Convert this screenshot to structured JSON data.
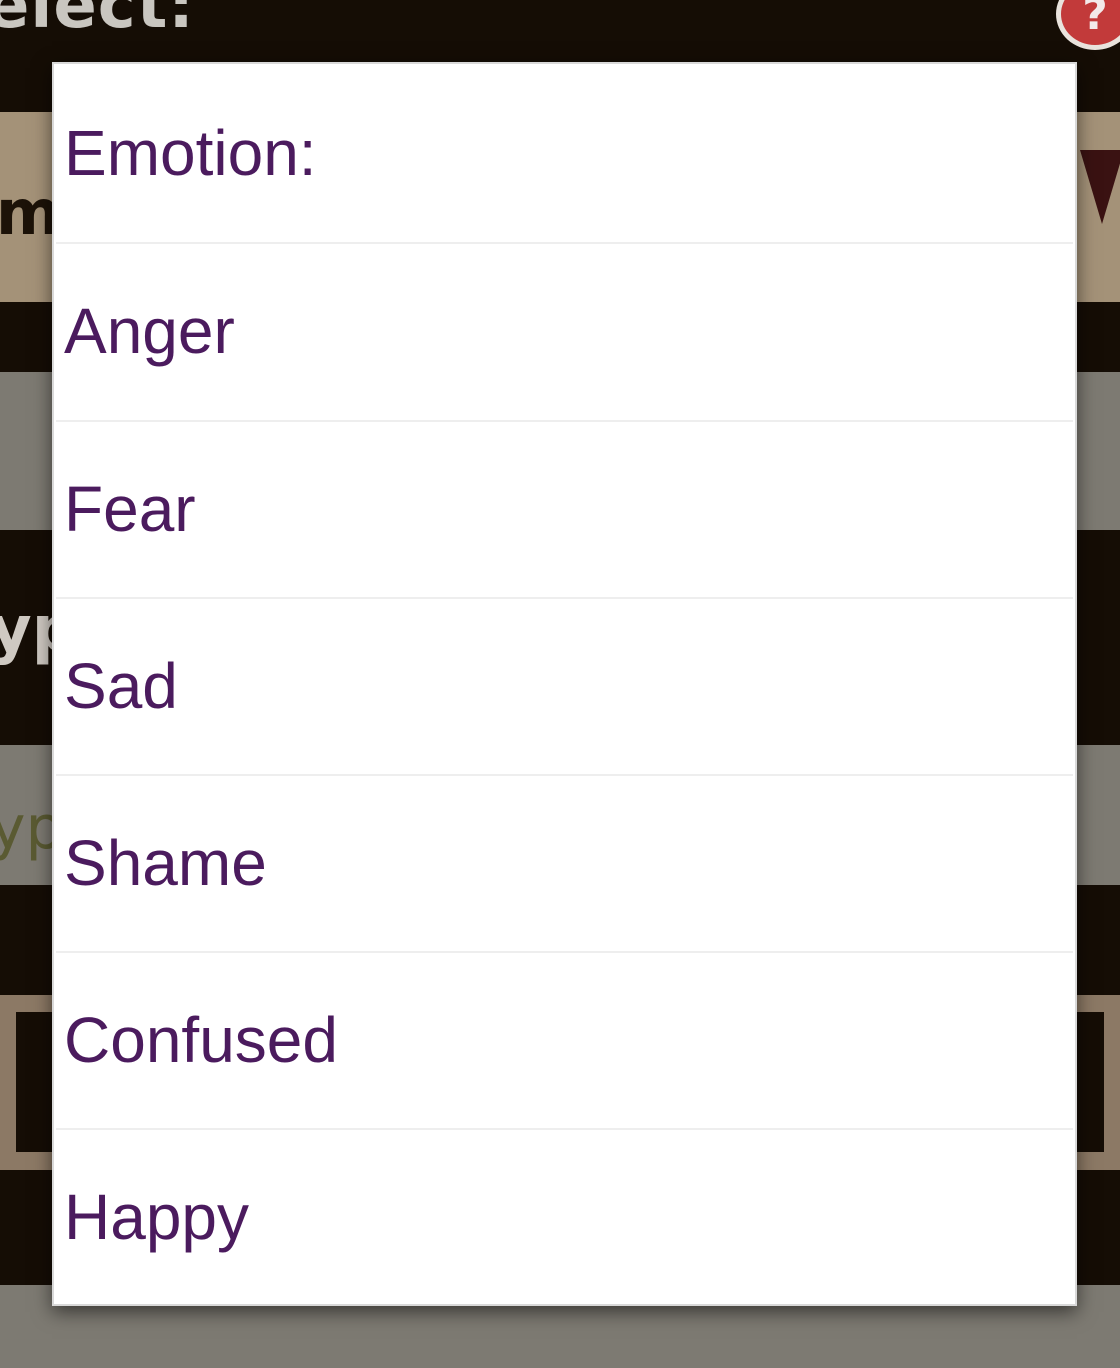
{
  "background": {
    "header_text": "elect:",
    "help_glyph": "?",
    "fragments": [
      "m",
      "yp",
      "yp"
    ],
    "colors": {
      "base": "#150d05",
      "band_tan": "#a49278",
      "band_grey": "#7d7a72",
      "header_text": "#c9c6c0",
      "help_icon": "#c23a3a"
    }
  },
  "dialog": {
    "options": [
      {
        "label": "Emotion:"
      },
      {
        "label": "Anger"
      },
      {
        "label": "Fear"
      },
      {
        "label": "Sad"
      },
      {
        "label": "Shame"
      },
      {
        "label": "Confused"
      },
      {
        "label": "Happy"
      }
    ],
    "colors": {
      "text": "#4b1b5e",
      "background": "#ffffff",
      "divider": "#eeeeee"
    }
  }
}
